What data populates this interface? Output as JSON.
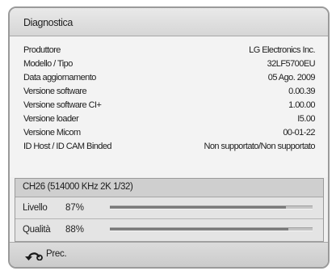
{
  "dialog": {
    "title": "Diagnostica"
  },
  "info": {
    "rows": [
      {
        "label": "Produttore",
        "value": "LG Electronics Inc."
      },
      {
        "label": "Modello / Tipo",
        "value": "32LF5700EU"
      },
      {
        "label": "Data aggiornamento",
        "value": "05 Ago. 2009"
      },
      {
        "label": "Versione software",
        "value": "0.00.39"
      },
      {
        "label": "Versione software CI+",
        "value": "1.00.00"
      },
      {
        "label": "Versione loader",
        "value": "I5.00"
      },
      {
        "label": "Versione Micom",
        "value": "00-01-22"
      },
      {
        "label": "ID Host / ID CAM Binded",
        "value": "Non supportato/Non supportato"
      }
    ]
  },
  "signal": {
    "channel": "CH26 (514000 KHz 2K 1/32)",
    "level": {
      "label": "Livello",
      "value": "87%",
      "fraction": 0.87
    },
    "quality": {
      "label": "Qualità",
      "value": "88%",
      "fraction": 0.88
    }
  },
  "footer": {
    "back_icon": "return-arrow-icon",
    "back_label": "Prec."
  }
}
